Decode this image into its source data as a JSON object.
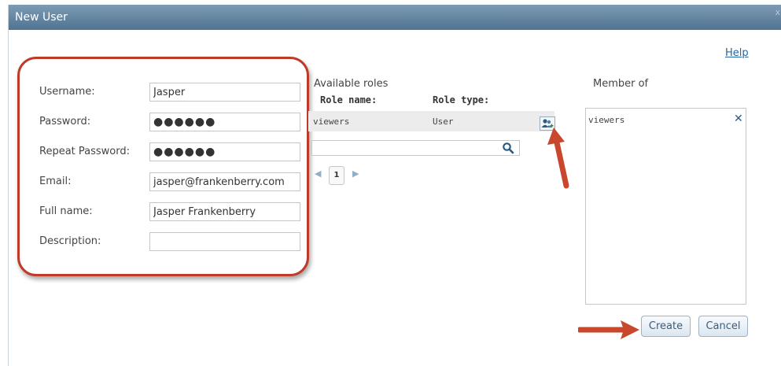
{
  "dialog": {
    "title": "New User",
    "close_label": "x",
    "help_label": "Help"
  },
  "form": {
    "username_label": "Username:",
    "username_value": "Jasper",
    "password_label": "Password:",
    "password_value": "●●●●●●",
    "repeat_password_label": "Repeat Password:",
    "repeat_password_value": "●●●●●●",
    "email_label": "Email:",
    "email_value": "jasper@frankenberry.com",
    "fullname_label": "Full name:",
    "fullname_value": "Jasper Frankenberry",
    "description_label": "Description:",
    "description_value": ""
  },
  "available_roles": {
    "title": "Available roles",
    "col_name": "Role name:",
    "col_type": "Role type:",
    "rows": [
      {
        "name": "viewers",
        "type": "User"
      }
    ],
    "search_value": "",
    "pager": {
      "prev": "◀",
      "page": "1",
      "next": "▶"
    }
  },
  "member_of": {
    "title": "Member of",
    "items": [
      "viewers"
    ],
    "remove_label": "✕"
  },
  "buttons": {
    "create": "Create",
    "cancel": "Cancel"
  },
  "colors": {
    "annotation": "#c8472d",
    "accent": "#2a5b85",
    "title_bar": "#5f7f9c"
  },
  "icons": {
    "add_role": "add-user-icon",
    "search": "search-icon"
  }
}
